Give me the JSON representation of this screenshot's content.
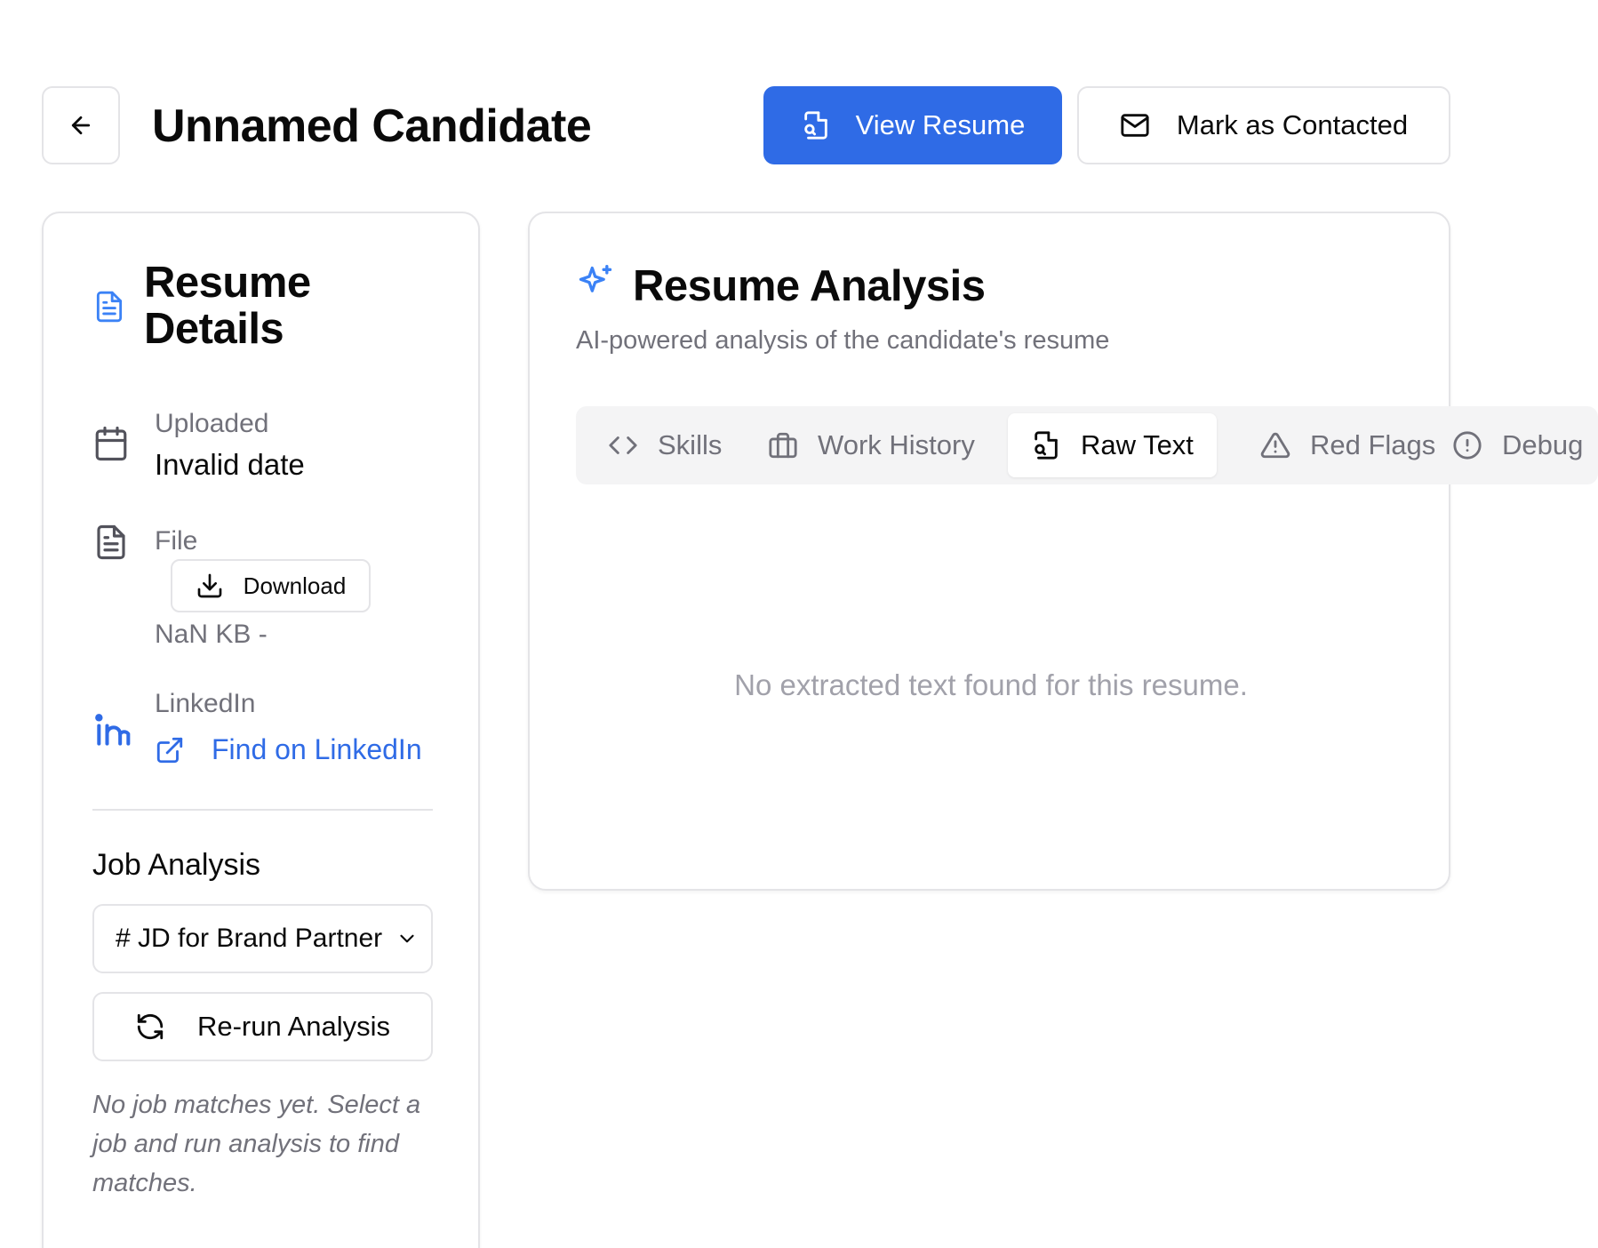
{
  "header": {
    "title": "Unnamed Candidate",
    "view_resume_label": "View Resume",
    "mark_contacted_label": "Mark as Contacted"
  },
  "resume_details": {
    "title": "Resume Details",
    "uploaded_label": "Uploaded",
    "uploaded_value": "Invalid date",
    "file_label": "File",
    "download_label": "Download",
    "file_size": "NaN KB -",
    "linkedin_label": "LinkedIn",
    "linkedin_link": "Find on LinkedIn"
  },
  "job_analysis": {
    "title": "Job Analysis",
    "selected_job": "# JD for Brand Partner",
    "rerun_label": "Re-run Analysis",
    "empty_text": "No job matches yet. Select a job and run analysis to find matches."
  },
  "analysis": {
    "title": "Resume Analysis",
    "subtitle": "AI-powered analysis of the candidate's resume",
    "tabs": [
      {
        "label": "Skills",
        "icon": "code-icon"
      },
      {
        "label": "Work History",
        "icon": "briefcase-icon"
      },
      {
        "label": "Raw Text",
        "icon": "file-search-icon",
        "active": true
      },
      {
        "label": "Red Flags",
        "icon": "alert-triangle-icon"
      },
      {
        "label": "Debug",
        "icon": "alert-circle-icon"
      }
    ],
    "empty_message": "No extracted text found for this resume."
  },
  "colors": {
    "primary": "#2f6be6",
    "border": "#e4e4e7",
    "muted_text": "#71717a"
  }
}
